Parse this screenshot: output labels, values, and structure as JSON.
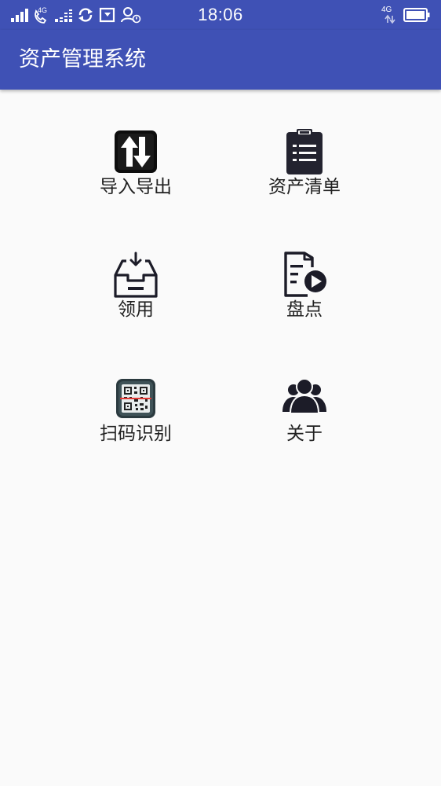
{
  "status_bar": {
    "time": "18:06",
    "network_left": "4G",
    "network_right": "4G",
    "icons": [
      "signal-icon",
      "call-icon",
      "signal2-icon",
      "sync-icon",
      "screenshot-icon",
      "user-icon",
      "battery-icon"
    ]
  },
  "app_bar": {
    "title": "资产管理系统"
  },
  "menu": {
    "items": [
      {
        "label": "导入导出",
        "icon": "import-export-icon"
      },
      {
        "label": "资产清单",
        "icon": "clipboard-list-icon"
      },
      {
        "label": "领用",
        "icon": "inbox-download-icon"
      },
      {
        "label": "盘点",
        "icon": "inventory-play-icon"
      },
      {
        "label": "扫码识别",
        "icon": "qr-scan-icon"
      },
      {
        "label": "关于",
        "icon": "group-icon"
      }
    ]
  },
  "colors": {
    "primary": "#3f51b5",
    "background": "#fafafa",
    "icon_dark": "#1c1c28",
    "text": "#212121",
    "scan_line": "#e53935"
  }
}
